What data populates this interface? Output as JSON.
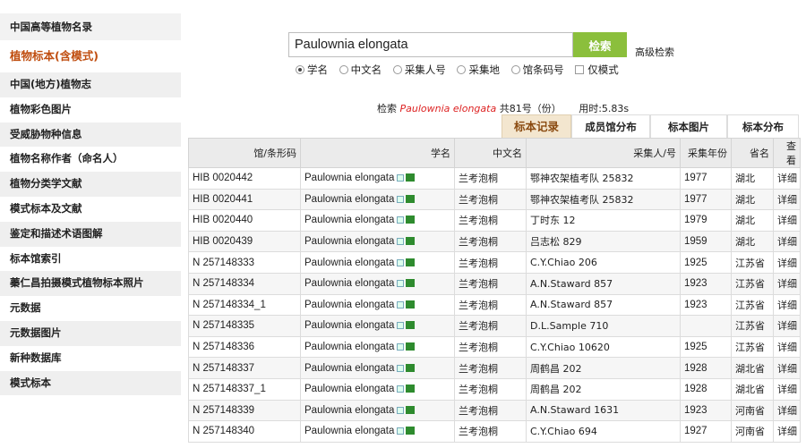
{
  "sidebar": {
    "items": [
      {
        "label": "中国高等植物名录"
      },
      {
        "label": "植物标本(含模式)"
      },
      {
        "label": "中国(地方)植物志"
      },
      {
        "label": "植物彩色图片"
      },
      {
        "label": "受威胁物种信息"
      },
      {
        "label": "植物名称作者（命名人）"
      },
      {
        "label": "植物分类学文献"
      },
      {
        "label": "模式标本及文献"
      },
      {
        "label": "鉴定和描述术语图解"
      },
      {
        "label": "标本馆索引"
      },
      {
        "label": "蓁仁昌拍摄模式植物标本照片"
      },
      {
        "label": "元数据"
      },
      {
        "label": "元数据图片"
      },
      {
        "label": "新种数据库"
      },
      {
        "label": "模式标本"
      }
    ]
  },
  "search": {
    "value": "Paulownia elongata",
    "button_label": "检索",
    "advanced_label": "高级检索",
    "options": [
      "学名",
      "中文名",
      "采集人号",
      "采集地",
      "馆条码号"
    ],
    "checkbox_label": "仅模式"
  },
  "summary": {
    "prefix": "检索",
    "term": "Paulownia elongata",
    "count_text": "共81号（份）",
    "time_text": "用时:5.83s"
  },
  "tabs": [
    "标本记录",
    "成员馆分布",
    "标本图片",
    "标本分布"
  ],
  "table": {
    "headers": [
      "馆/条形码",
      "学名",
      "中文名",
      "采集人/号",
      "采集年份",
      "省名",
      "查看"
    ],
    "rows": [
      {
        "code": "HIB 0020442",
        "sci": "Paulownia elongata",
        "cn": "兰考泡桐",
        "collector": "鄂神农架植考队 25832",
        "year": "1977",
        "prov": "湖北",
        "view": "详细"
      },
      {
        "code": "HIB 0020441",
        "sci": "Paulownia elongata",
        "cn": "兰考泡桐",
        "collector": "鄂神农架植考队 25832",
        "year": "1977",
        "prov": "湖北",
        "view": "详细"
      },
      {
        "code": "HIB 0020440",
        "sci": "Paulownia elongata",
        "cn": "兰考泡桐",
        "collector": "丁时东 12",
        "year": "1979",
        "prov": "湖北",
        "view": "详细"
      },
      {
        "code": "HIB 0020439",
        "sci": "Paulownia elongata",
        "cn": "兰考泡桐",
        "collector": "吕志松 829",
        "year": "1959",
        "prov": "湖北",
        "view": "详细"
      },
      {
        "code": "N 257148333",
        "sci": "Paulownia elongata",
        "cn": "兰考泡桐",
        "collector": "C.Y.Chiao 206",
        "year": "1925",
        "prov": "江苏省",
        "view": "详细"
      },
      {
        "code": "N 257148334",
        "sci": "Paulownia elongata",
        "cn": "兰考泡桐",
        "collector": "A.N.Staward 857",
        "year": "1923",
        "prov": "江苏省",
        "view": "详细"
      },
      {
        "code": "N 257148334_1",
        "sci": "Paulownia elongata",
        "cn": "兰考泡桐",
        "collector": "A.N.Staward 857",
        "year": "1923",
        "prov": "江苏省",
        "view": "详细"
      },
      {
        "code": "N 257148335",
        "sci": "Paulownia elongata",
        "cn": "兰考泡桐",
        "collector": "D.L.Sample 710",
        "year": "",
        "prov": "江苏省",
        "view": "详细"
      },
      {
        "code": "N 257148336",
        "sci": "Paulownia elongata",
        "cn": "兰考泡桐",
        "collector": "C.Y.Chiao 10620",
        "year": "1925",
        "prov": "江苏省",
        "view": "详细"
      },
      {
        "code": "N 257148337",
        "sci": "Paulownia elongata",
        "cn": "兰考泡桐",
        "collector": "周鹤昌 202",
        "year": "1928",
        "prov": "湖北省",
        "view": "详细"
      },
      {
        "code": "N 257148337_1",
        "sci": "Paulownia elongata",
        "cn": "兰考泡桐",
        "collector": "周鹤昌 202",
        "year": "1928",
        "prov": "湖北省",
        "view": "详细"
      },
      {
        "code": "N 257148339",
        "sci": "Paulownia elongata",
        "cn": "兰考泡桐",
        "collector": "A.N.Staward 1631",
        "year": "1923",
        "prov": "河南省",
        "view": "详细"
      },
      {
        "code": "N 257148340",
        "sci": "Paulownia elongata",
        "cn": "兰考泡桐",
        "collector": "C.Y.Chiao 694",
        "year": "1927",
        "prov": "河南省",
        "view": "详细"
      }
    ]
  }
}
